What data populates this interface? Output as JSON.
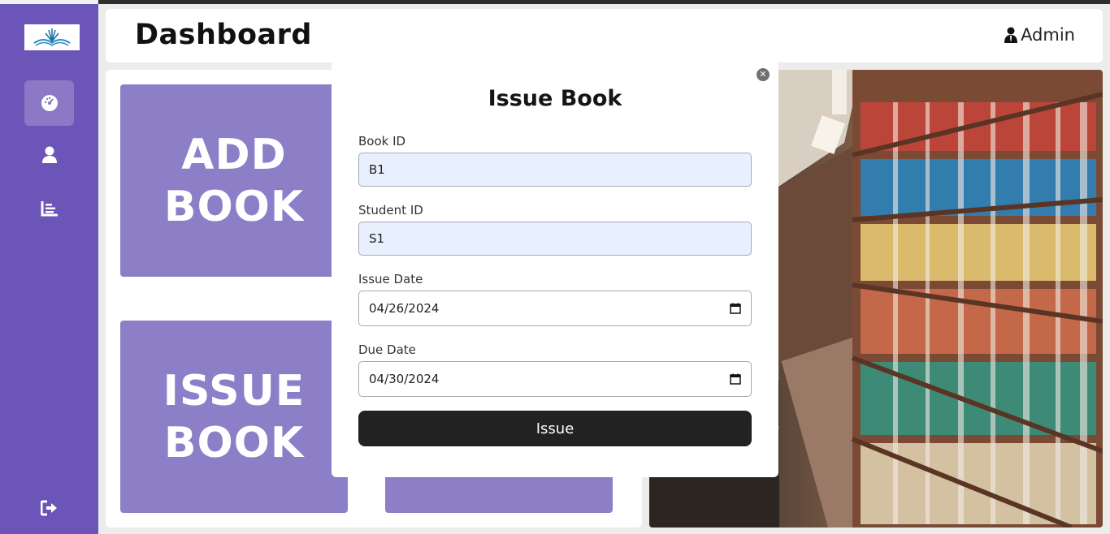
{
  "header": {
    "title": "Dashboard",
    "user_label": "Admin"
  },
  "sidebar": {
    "items": [
      {
        "name": "dashboard",
        "icon": "gauge-icon",
        "active": true
      },
      {
        "name": "students",
        "icon": "user-icon",
        "active": false
      },
      {
        "name": "reports",
        "icon": "chart-icon",
        "active": false
      }
    ],
    "logout_icon": "logout-icon"
  },
  "cards": {
    "add_book": "ADD\nBOOK",
    "issue_book": "ISSUE\nBOOK"
  },
  "modal": {
    "title": "Issue Book",
    "book_id_label": "Book ID",
    "book_id_value": "B1",
    "student_id_label": "Student ID",
    "student_id_value": "S1",
    "issue_date_label": "Issue Date",
    "issue_date_value": "04/26/2024",
    "due_date_label": "Due Date",
    "due_date_value": "04/30/2024",
    "submit_label": "Issue"
  },
  "colors": {
    "sidebar": "#6b55b8",
    "card": "#8c7fc8",
    "button": "#222222"
  }
}
